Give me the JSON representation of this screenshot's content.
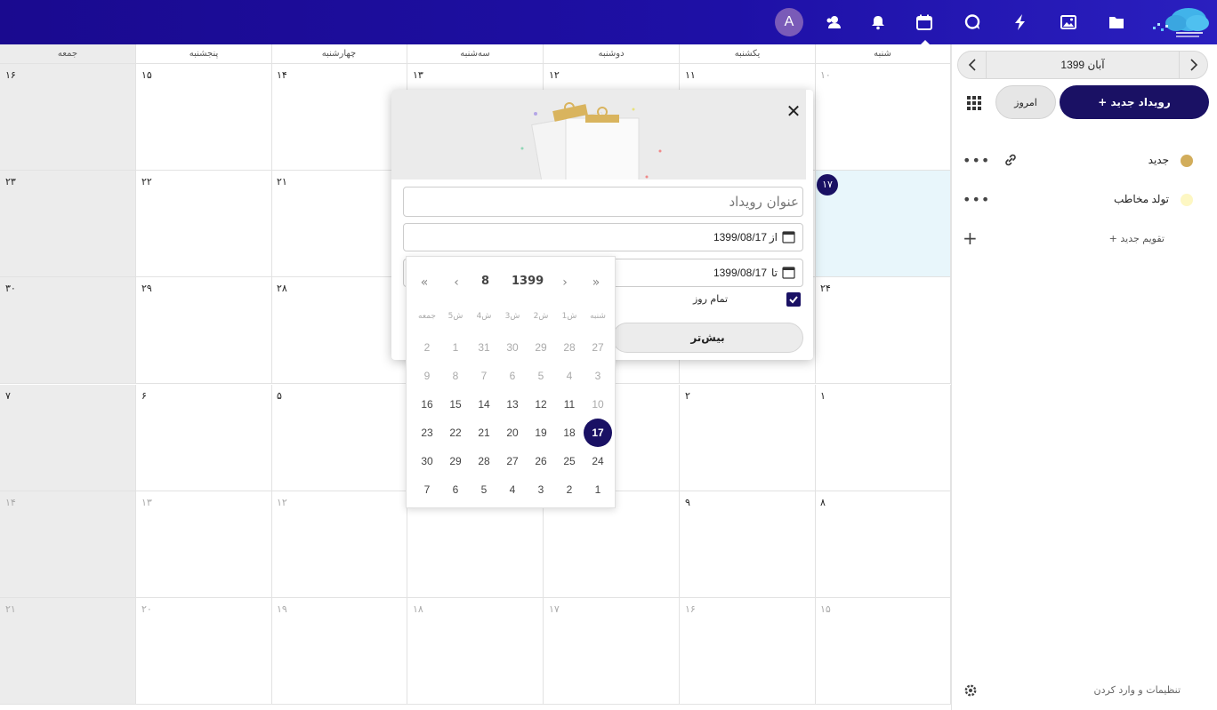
{
  "topbar": {
    "avatar_initial": "A",
    "icons": [
      "contacts-icon",
      "notifications-icon",
      "calendar-icon",
      "talk-icon",
      "activity-icon",
      "photos-icon",
      "files-icon"
    ]
  },
  "week_headers": [
    "شنبه",
    "یکشنبه",
    "دوشنبه",
    "سه‌شنبه",
    "چهارشنبه",
    "پنجشنبه",
    "جمعه"
  ],
  "weeks": [
    [
      "۱۰",
      "۱۱",
      "۱۲",
      "۱۳",
      "۱۴",
      "۱۵",
      "۱۶"
    ],
    [
      "۱۷",
      "",
      "",
      "",
      "۲۱",
      "۲۲",
      "۲۳"
    ],
    [
      "۲۴",
      "",
      "",
      "",
      "۲۸",
      "۲۹",
      "۳۰"
    ],
    [
      "۱",
      "۲",
      "",
      "",
      "۵",
      "۶",
      "۷"
    ],
    [
      "۸",
      "۹",
      "",
      "",
      "۱۲",
      "۱۳",
      "۱۴"
    ],
    [
      "۱۵",
      "۱۶",
      "۱۷",
      "۱۸",
      "۱۹",
      "۲۰",
      "۲۱"
    ]
  ],
  "sidebar": {
    "month_label": "آبان 1399",
    "new_event": "+ رویداد جدید",
    "today": "امروز",
    "calendars": [
      {
        "name": "جدید",
        "color": "#d2ad5b"
      },
      {
        "name": "تولد مخاطب",
        "color": "#fdf7c3"
      }
    ],
    "add_calendar": "+ تقویم جدید",
    "settings": "تنظیمات و وارد کردن"
  },
  "popover": {
    "title_placeholder": "عنوان رویداد",
    "from_label": "از",
    "from_value": "1399/08/17",
    "to_label": "تا",
    "to_value": "1399/08/17",
    "all_day": "تمام روز",
    "more": "بیش‌تر"
  },
  "datepicker": {
    "month": "8",
    "year": "1399",
    "weekdays": [
      "شنبه",
      "1ش",
      "2ش",
      "3ش",
      "4ش",
      "5ش",
      "جمعه"
    ],
    "rows": [
      [
        "27",
        "28",
        "29",
        "30",
        "31",
        "1",
        "2"
      ],
      [
        "3",
        "4",
        "5",
        "6",
        "7",
        "8",
        "9"
      ],
      [
        "10",
        "11",
        "12",
        "13",
        "14",
        "15",
        "16"
      ],
      [
        "17",
        "18",
        "19",
        "20",
        "21",
        "22",
        "23"
      ],
      [
        "24",
        "25",
        "26",
        "27",
        "28",
        "29",
        "30"
      ],
      [
        "1",
        "2",
        "3",
        "4",
        "5",
        "6",
        "7"
      ]
    ],
    "muted": [
      [
        true,
        true,
        true,
        true,
        true,
        true,
        true
      ],
      [
        true,
        true,
        true,
        true,
        true,
        true,
        true
      ],
      [
        true,
        false,
        false,
        false,
        false,
        false,
        false
      ],
      [
        false,
        false,
        false,
        false,
        false,
        false,
        false
      ],
      [
        false,
        false,
        false,
        false,
        false,
        false,
        false
      ],
      [
        false,
        false,
        false,
        false,
        false,
        false,
        false
      ]
    ],
    "selected": "17"
  },
  "colors": {
    "accent": "#1a1164",
    "topbar": "#1e10a6",
    "today_bg": "#e8f6fb"
  }
}
